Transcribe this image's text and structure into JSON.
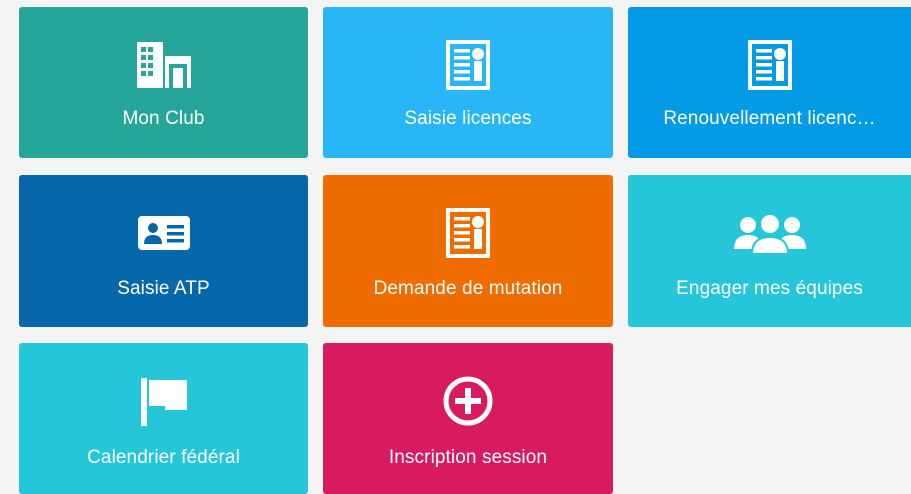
{
  "tiles": [
    {
      "label": "Mon Club",
      "icon": "building-icon",
      "color": "#26a69a"
    },
    {
      "label": "Saisie licences",
      "icon": "license-certificate-icon",
      "color": "#29b6f6"
    },
    {
      "label": "Renouvellement licenc…",
      "icon": "license-certificate-icon",
      "color": "#039be5"
    },
    {
      "label": "Saisie ATP",
      "icon": "id-card-icon",
      "color": "#0767ab"
    },
    {
      "label": "Demande de mutation",
      "icon": "license-certificate-icon",
      "color": "#ef6c00"
    },
    {
      "label": "Engager mes équipes",
      "icon": "users-group-icon",
      "color": "#26c6da"
    },
    {
      "label": "Calendrier fédéral",
      "icon": "flag-icon",
      "color": "#26c6da"
    },
    {
      "label": "Inscription session",
      "icon": "plus-circle-icon",
      "color": "#d81b60"
    }
  ]
}
